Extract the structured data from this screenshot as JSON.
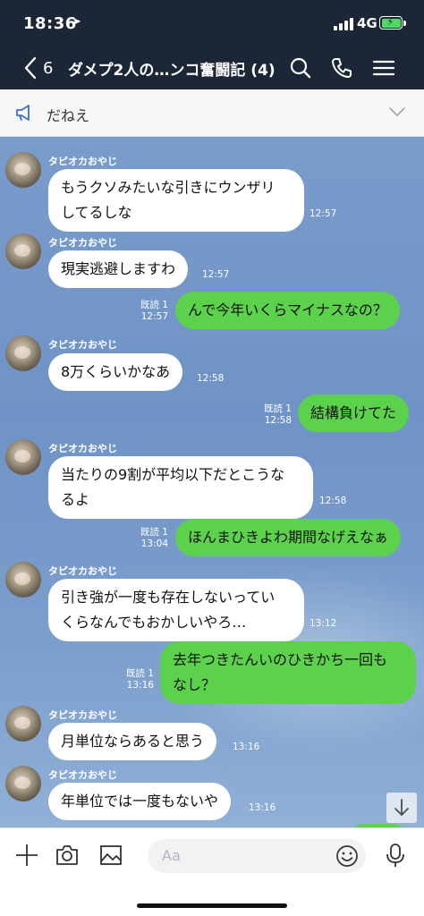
{
  "status": {
    "time": "18:36",
    "location_glyph": "➤",
    "network": "4G"
  },
  "header": {
    "back_count": "6",
    "title": "ダメプ2人の…ンコ奮闘記 (4)"
  },
  "notice": {
    "text": "だねえ"
  },
  "messages": [
    {
      "sender": "タピオカおやじ",
      "lines": [
        "もうクソみたいな引きにウンザリ",
        "してるしな"
      ],
      "time": "12:57"
    },
    {
      "sender": "タピオカおやじ",
      "lines": [
        "現実逃避しますわ"
      ],
      "time": "12:57"
    },
    {
      "read": "既読 1",
      "lines": [
        "んで今年いくらマイナスなの？"
      ],
      "time": "12:57"
    },
    {
      "sender": "タピオカおやじ",
      "lines": [
        "8万くらいかなあ"
      ],
      "time": "12:58"
    },
    {
      "read": "既読 1",
      "lines": [
        "結構負けてた"
      ],
      "time": "12:58"
    },
    {
      "sender": "タピオカおやじ",
      "lines": [
        "当たりの9割が平均以下だとこうな",
        "るよ"
      ],
      "time": "12:58"
    },
    {
      "read": "既読 1",
      "lines": [
        "ほんまひきよわ期間なげえなぁ"
      ],
      "time": "13:04"
    },
    {
      "sender": "タピオカおやじ",
      "lines": [
        "引き強が一度も存在しないってい",
        "くらなんでもおかしいやろ…"
      ],
      "time": "13:12"
    },
    {
      "read": "既読 1",
      "lines": [
        "去年つきたんいのひきかち一回も",
        "なし？"
      ],
      "time": "13:16"
    },
    {
      "sender": "タピオカおやじ",
      "lines": [
        "月単位ならあると思う"
      ],
      "time": "13:16"
    },
    {
      "sender": "タピオカおやじ",
      "lines": [
        "年単位では一度もないや"
      ],
      "time": "13:16"
    }
  ],
  "input": {
    "placeholder": "Aa"
  },
  "colors": {
    "header_bg": "#1b2637",
    "outgoing_bubble": "#5bd14c",
    "incoming_bubble": "#ffffff",
    "chat_bg": "#7597c8"
  },
  "icons": [
    "back-chevron-icon",
    "search-icon",
    "phone-icon",
    "menu-icon",
    "megaphone-icon",
    "chevron-down-icon",
    "plus-icon",
    "camera-icon",
    "image-icon",
    "emoji-icon",
    "microphone-icon",
    "scroll-down-icon"
  ]
}
